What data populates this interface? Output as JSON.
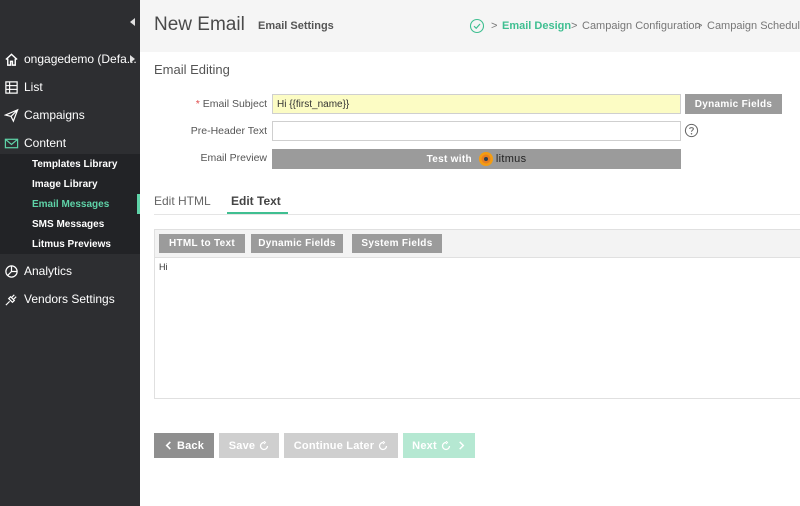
{
  "sidebar": {
    "account": {
      "label": "ongagedemo (Defa...",
      "icon": "home-icon"
    },
    "items": [
      {
        "label": "List",
        "icon": "list-icon"
      },
      {
        "label": "Campaigns",
        "icon": "paper-plane-icon"
      },
      {
        "label": "Content",
        "icon": "envelope-icon"
      }
    ],
    "content_sub": [
      {
        "label": "Templates Library"
      },
      {
        "label": "Image Library"
      },
      {
        "label": "Email Messages"
      },
      {
        "label": "SMS Messages"
      },
      {
        "label": "Litmus Previews"
      }
    ],
    "bottom_items": [
      {
        "label": "Analytics",
        "icon": "pie-chart-icon"
      },
      {
        "label": "Vendors Settings",
        "icon": "plug-icon"
      }
    ],
    "active_color": "#5fd3a8",
    "background": "#2d2e31"
  },
  "header": {
    "title": "New Email",
    "steps": [
      {
        "label": "Email Settings",
        "state": "done"
      },
      {
        "label": "Email Design",
        "state": "active"
      },
      {
        "label": "Campaign Configuration",
        "state": "pending"
      },
      {
        "label": "Campaign Scheduling",
        "state": "pending"
      }
    ],
    "separator": ">"
  },
  "form": {
    "section_title": "Email Editing",
    "subject": {
      "label": "Email Subject",
      "required_mark": "*",
      "value": "Hi {{first_name}}"
    },
    "dynamic_fields_label": "Dynamic Fields",
    "preheader": {
      "label": "Pre-Header Text",
      "value": ""
    },
    "preview": {
      "label": "Email Preview",
      "button_label": "Test with",
      "brand": "litmus"
    }
  },
  "tabs": [
    {
      "label": "Edit HTML",
      "active": false
    },
    {
      "label": "Edit Text",
      "active": true
    }
  ],
  "editor": {
    "toolbar": [
      "HTML to Text",
      "Dynamic Fields",
      "System Fields"
    ],
    "content": "Hi"
  },
  "actions": {
    "back": "Back",
    "save": "Save",
    "continue_later": "Continue Later",
    "next": "Next"
  },
  "colors": {
    "accent": "#3fbf91",
    "button_gray": "#9b9b9b",
    "subject_bg": "#fcfcc4"
  }
}
